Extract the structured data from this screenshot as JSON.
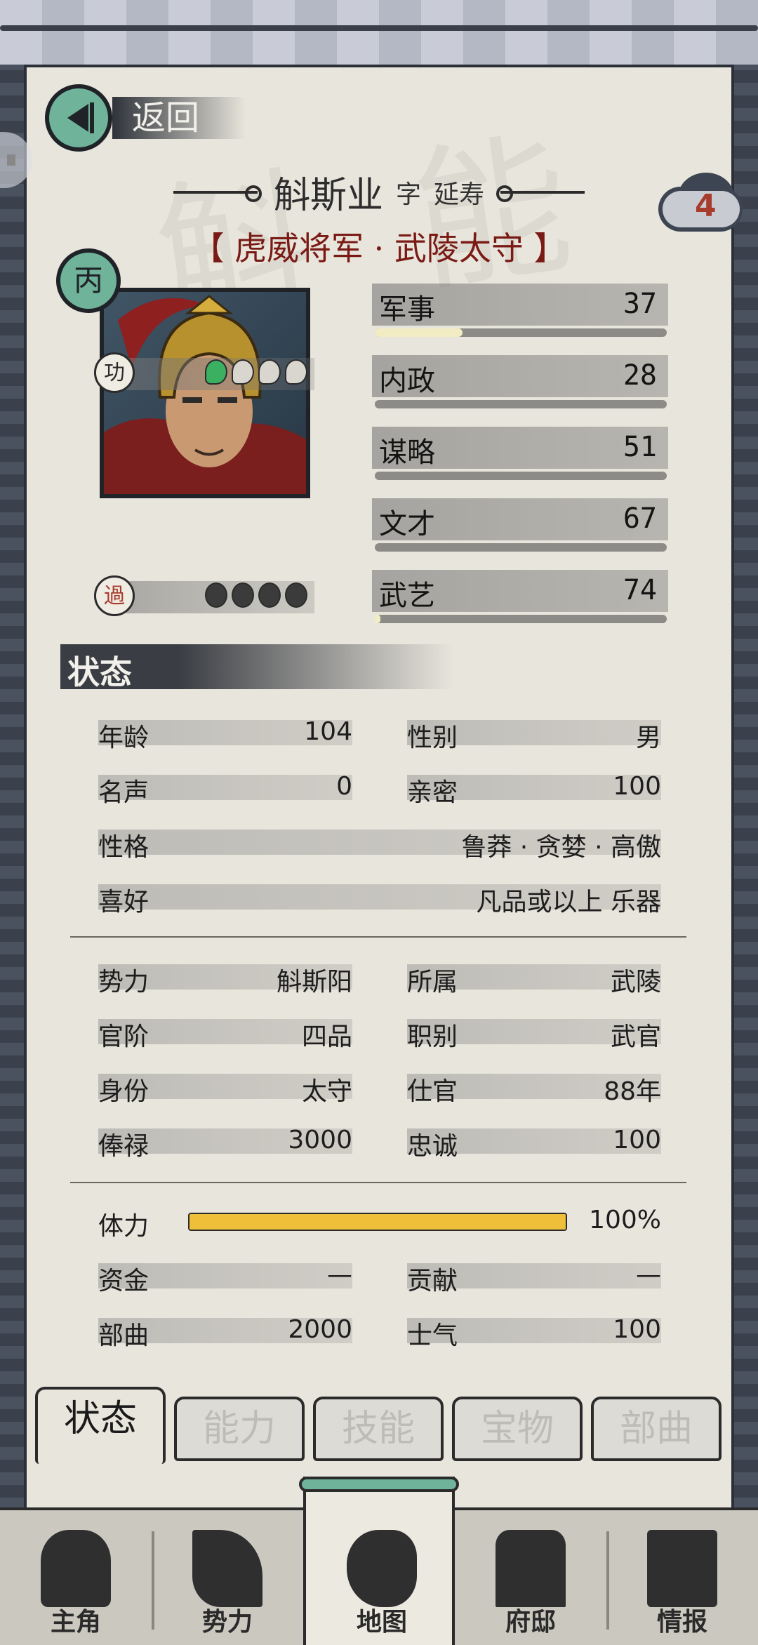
{
  "back": {
    "label": "返回"
  },
  "character": {
    "name": "斛斯业",
    "courtesy_prefix": "字",
    "courtesy_name": "延寿",
    "title": "【 虎威将军 · 武陵太守 】",
    "grade": "丙",
    "badge_count": "4"
  },
  "merit": {
    "icon_text": "功",
    "filled": 1,
    "total": 4
  },
  "demerit": {
    "icon_text": "過",
    "total": 4
  },
  "attributes": [
    {
      "label": "军事",
      "value": "37",
      "progress": 0.3
    },
    {
      "label": "内政",
      "value": "28",
      "progress": 0.0
    },
    {
      "label": "谋略",
      "value": "51",
      "progress": 0.0
    },
    {
      "label": "文才",
      "value": "67",
      "progress": 0.0
    },
    {
      "label": "武艺",
      "value": "74",
      "progress": 0.02
    }
  ],
  "section_title": "状态",
  "status": {
    "age": {
      "key": "年龄",
      "value": "104"
    },
    "gender": {
      "key": "性别",
      "value": "男"
    },
    "fame": {
      "key": "名声",
      "value": "0"
    },
    "intimacy": {
      "key": "亲密",
      "value": "100"
    },
    "personality": {
      "key": "性格",
      "value": "鲁莽 · 贪婪 · 高傲"
    },
    "hobby": {
      "key": "喜好",
      "value": "凡品或以上 乐器"
    },
    "faction": {
      "key": "势力",
      "value": "斛斯阳"
    },
    "belong": {
      "key": "所属",
      "value": "武陵"
    },
    "rank": {
      "key": "官阶",
      "value": "四品"
    },
    "post_type": {
      "key": "职别",
      "value": "武官"
    },
    "identity": {
      "key": "身份",
      "value": "太守"
    },
    "service": {
      "key": "仕官",
      "value": "88年"
    },
    "salary": {
      "key": "俸禄",
      "value": "3000"
    },
    "loyalty": {
      "key": "忠诚",
      "value": "100"
    },
    "stamina": {
      "key": "体力",
      "value": "100%",
      "fraction": 1.0
    },
    "funds": {
      "key": "资金",
      "value": "—"
    },
    "contribution": {
      "key": "贡献",
      "value": "—"
    },
    "troops": {
      "key": "部曲",
      "value": "2000"
    },
    "morale": {
      "key": "士气",
      "value": "100"
    }
  },
  "tabs": [
    "状态",
    "能力",
    "技能",
    "宝物",
    "部曲"
  ],
  "nav": [
    "主角",
    "势力",
    "地图",
    "府邸",
    "情报"
  ],
  "colors": {
    "accent_green": "#6fb39a",
    "title_red": "#7a1a14",
    "stamina": "#f0bf3a",
    "frame": "#3d4452"
  }
}
